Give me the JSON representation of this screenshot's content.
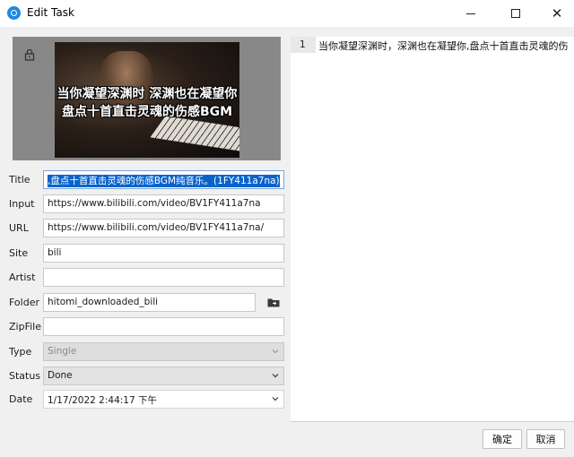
{
  "window": {
    "title": "Edit Task"
  },
  "thumbnail": {
    "line1": "当你凝望深渊时 深渊也在凝望你",
    "line2": "盘点十首直击灵魂的伤感BGM"
  },
  "form": {
    "title": {
      "label": "Title",
      "value": ",盘点十首直击灵魂的伤感BGM纯音乐。(1FY411a7na)"
    },
    "input": {
      "label": "Input",
      "value": "https://www.bilibili.com/video/BV1FY411a7na"
    },
    "url": {
      "label": "URL",
      "value": "https://www.bilibili.com/video/BV1FY411a7na/"
    },
    "site": {
      "label": "Site",
      "value": "bili"
    },
    "artist": {
      "label": "Artist",
      "value": ""
    },
    "folder": {
      "label": "Folder",
      "value": "hitomi_downloaded_bili"
    },
    "zipfile": {
      "label": "ZipFile",
      "value": ""
    },
    "type": {
      "label": "Type",
      "value": "Single"
    },
    "status": {
      "label": "Status",
      "value": "Done"
    },
    "date": {
      "label": "Date",
      "value": "1/17/2022 2:44:17 下午"
    }
  },
  "editor": {
    "line_number": "1",
    "line_text": "当你凝望深渊时，深渊也在凝望你,盘点十首直击灵魂的伤"
  },
  "buttons": {
    "ok": "确定",
    "cancel": "取消"
  },
  "colors": {
    "selection": "#0a63c9",
    "accent": "#1e88e5"
  }
}
